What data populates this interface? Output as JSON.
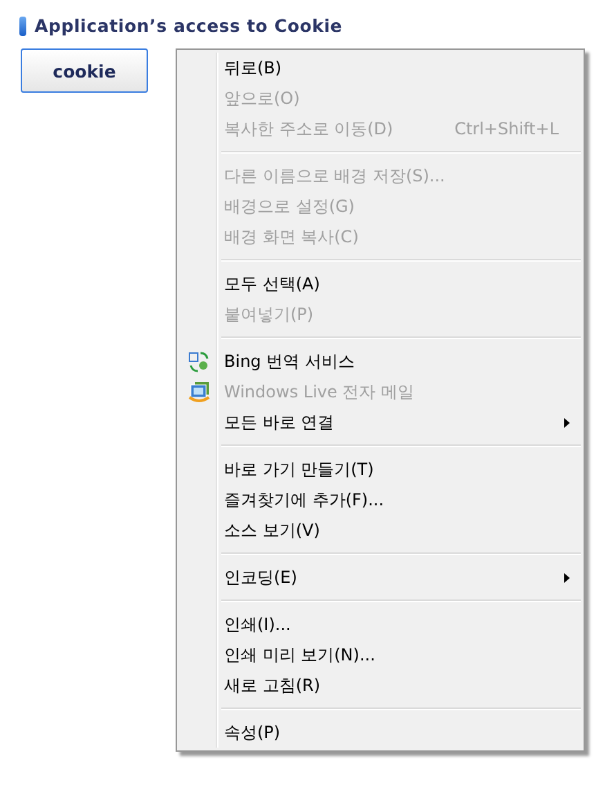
{
  "heading": "Application’s access to Cookie",
  "button": {
    "label": "cookie"
  },
  "context_menu": {
    "items": [
      {
        "kind": "item",
        "label": "뒤로(B)",
        "disabled": false
      },
      {
        "kind": "item",
        "label": "앞으로(O)",
        "disabled": true
      },
      {
        "kind": "item",
        "label": "복사한 주소로 이동(D)",
        "disabled": true,
        "shortcut": "Ctrl+Shift+L"
      },
      {
        "kind": "separator"
      },
      {
        "kind": "item",
        "label": "다른 이름으로 배경 저장(S)...",
        "disabled": true
      },
      {
        "kind": "item",
        "label": "배경으로 설정(G)",
        "disabled": true
      },
      {
        "kind": "item",
        "label": "배경 화면 복사(C)",
        "disabled": true
      },
      {
        "kind": "separator"
      },
      {
        "kind": "item",
        "label": "모두 선택(A)",
        "disabled": false
      },
      {
        "kind": "item",
        "label": "붙여넣기(P)",
        "disabled": true
      },
      {
        "kind": "separator"
      },
      {
        "kind": "icon_item",
        "label": "Bing 번역 서비스",
        "disabled": false
      },
      {
        "kind": "icon_item",
        "label": "Windows Live 전자 메일",
        "disabled": true
      },
      {
        "kind": "item",
        "label": "모든 바로 연결",
        "disabled": false,
        "submenu": true
      },
      {
        "kind": "separator"
      },
      {
        "kind": "item",
        "label": "바로 가기 만들기(T)",
        "disabled": false
      },
      {
        "kind": "item",
        "label": "즐겨찾기에 추가(F)...",
        "disabled": false
      },
      {
        "kind": "item",
        "label": "소스 보기(V)",
        "disabled": false
      },
      {
        "kind": "separator"
      },
      {
        "kind": "item",
        "label": "인코딩(E)",
        "disabled": false,
        "submenu": true
      },
      {
        "kind": "separator"
      },
      {
        "kind": "item",
        "label": "인쇄(I)...",
        "disabled": false
      },
      {
        "kind": "item",
        "label": "인쇄 미리 보기(N)...",
        "disabled": false
      },
      {
        "kind": "item",
        "label": "새로 고침(R)",
        "disabled": false
      },
      {
        "kind": "separator"
      },
      {
        "kind": "item",
        "label": "속성(P)",
        "disabled": false
      }
    ]
  }
}
